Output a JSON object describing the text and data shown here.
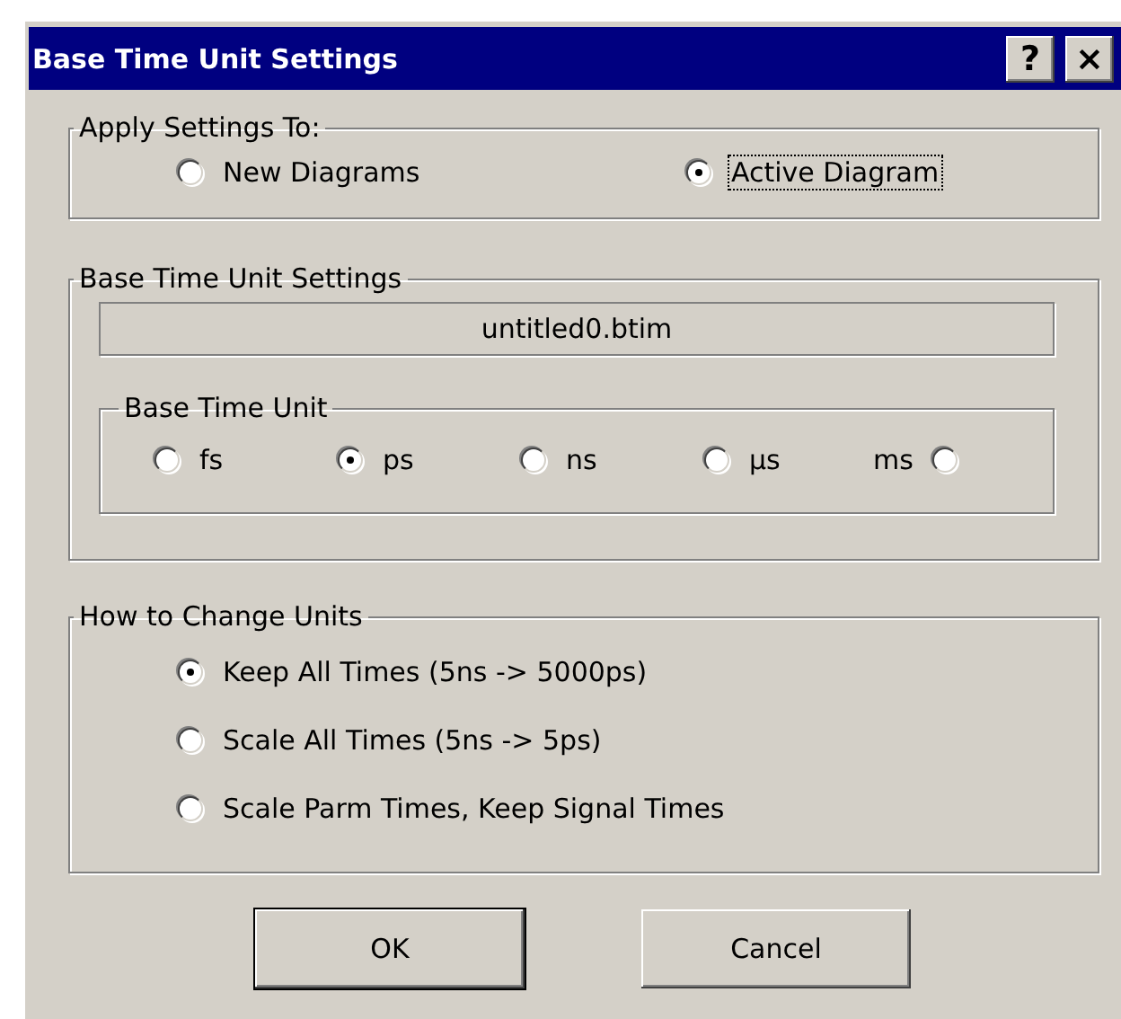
{
  "window": {
    "title": "Base Time Unit Settings",
    "title_buttons": [
      "?",
      "×"
    ]
  },
  "apply_settings": {
    "legend": "Apply Settings To:",
    "options": [
      {
        "label": "New Diagrams",
        "selected": false,
        "focused": false
      },
      {
        "label": "Active Diagram",
        "selected": true,
        "focused": true
      }
    ]
  },
  "base_time_unit_settings": {
    "legend": "Base Time Unit Settings",
    "file_name": "untitled0.btim",
    "base_time_unit": {
      "legend": "Base Time Unit",
      "options": [
        {
          "label": "fs",
          "selected": false,
          "label_left": false
        },
        {
          "label": "ps",
          "selected": true,
          "label_left": false
        },
        {
          "label": "ns",
          "selected": false,
          "label_left": false
        },
        {
          "label": "µs",
          "selected": false,
          "label_left": false
        },
        {
          "label": "ms",
          "selected": false,
          "label_left": true
        }
      ]
    }
  },
  "how_to_change_units": {
    "legend": "How to Change Units",
    "options": [
      {
        "label": "Keep All Times (5ns -> 5000ps)",
        "selected": true
      },
      {
        "label": "Scale All Times (5ns -> 5ps)",
        "selected": false
      },
      {
        "label": "Scale Parm Times, Keep Signal Times",
        "selected": false
      }
    ]
  },
  "buttons": [
    "OK",
    "Cancel"
  ]
}
